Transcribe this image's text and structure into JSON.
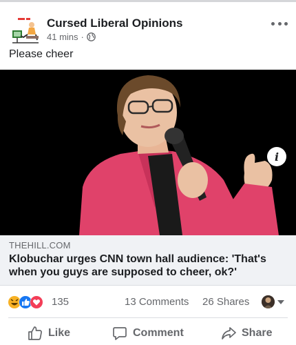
{
  "post": {
    "page_name": "Cursed Liberal Opinions",
    "time": "41 mins",
    "separator": "·",
    "text": "Please cheer"
  },
  "link": {
    "domain": "THEHILL.COM",
    "title": "Klobuchar urges CNN town hall audience: 'That's when you guys are supposed to cheer, ok?'"
  },
  "stats": {
    "reactions": "135",
    "comments": "13 Comments",
    "shares": "26 Shares"
  },
  "actions": {
    "like": "Like",
    "comment": "Comment",
    "share": "Share"
  },
  "icons": {
    "globe": "globe-icon",
    "more": "more-options-icon",
    "info": "info-icon",
    "like": "thumbs-up-icon",
    "comment": "speech-bubble-icon",
    "share": "share-arrow-icon"
  },
  "colors": {
    "text": "#1c1e21",
    "secondary": "#65676b",
    "preview_bg": "#f0f2f5",
    "like_blue": "#1877f2",
    "love_red": "#f33e58",
    "haha_yellow": "#f7b125"
  }
}
